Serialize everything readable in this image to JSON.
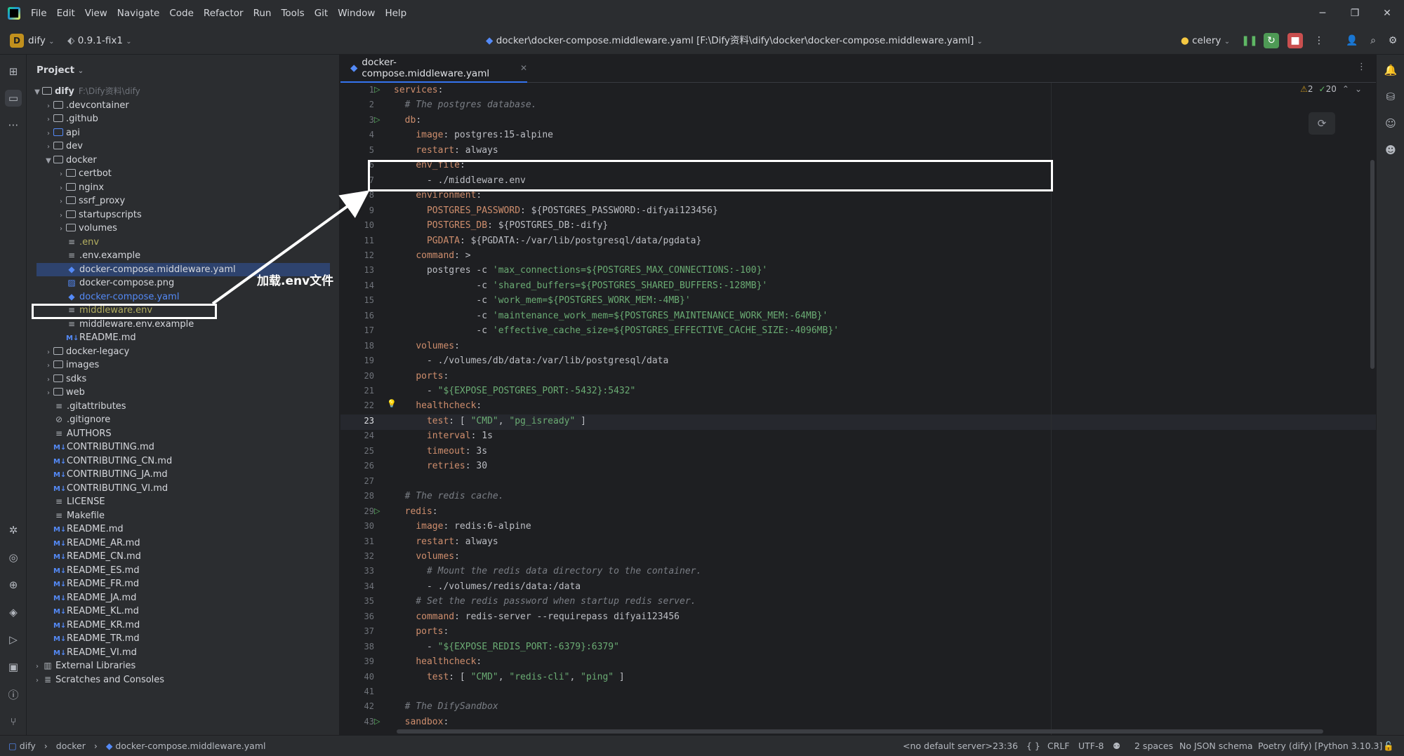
{
  "menu": [
    "File",
    "Edit",
    "View",
    "Navigate",
    "Code",
    "Refactor",
    "Run",
    "Tools",
    "Git",
    "Window",
    "Help"
  ],
  "toolbar": {
    "project_badge": "D",
    "project_name": "dify",
    "branch": "0.9.1-fix1",
    "file_path": "docker\\docker-compose.middleware.yaml [F:\\Dify资料\\dify\\docker\\docker-compose.middleware.yaml]",
    "run_config": "celery"
  },
  "project_panel": {
    "title": "Project",
    "root_name": "dify",
    "root_path": "F:\\Dify资料\\dify",
    "items": [
      {
        "label": ".devcontainer"
      },
      {
        "label": ".github"
      },
      {
        "label": "api"
      },
      {
        "label": "dev"
      },
      {
        "label": "docker"
      },
      {
        "label": "certbot"
      },
      {
        "label": "nginx"
      },
      {
        "label": "ssrf_proxy"
      },
      {
        "label": "startupscripts"
      },
      {
        "label": "volumes"
      },
      {
        "label": ".env"
      },
      {
        "label": ".env.example"
      },
      {
        "label": "docker-compose.middleware.yaml"
      },
      {
        "label": "docker-compose.png"
      },
      {
        "label": "docker-compose.yaml"
      },
      {
        "label": "middleware.env"
      },
      {
        "label": "middleware.env.example"
      },
      {
        "label": "README.md"
      },
      {
        "label": "docker-legacy"
      },
      {
        "label": "images"
      },
      {
        "label": "sdks"
      },
      {
        "label": "web"
      },
      {
        "label": ".gitattributes"
      },
      {
        "label": ".gitignore"
      },
      {
        "label": "AUTHORS"
      },
      {
        "label": "CONTRIBUTING.md"
      },
      {
        "label": "CONTRIBUTING_CN.md"
      },
      {
        "label": "CONTRIBUTING_JA.md"
      },
      {
        "label": "CONTRIBUTING_VI.md"
      },
      {
        "label": "LICENSE"
      },
      {
        "label": "Makefile"
      },
      {
        "label": "README.md"
      },
      {
        "label": "README_AR.md"
      },
      {
        "label": "README_CN.md"
      },
      {
        "label": "README_ES.md"
      },
      {
        "label": "README_FR.md"
      },
      {
        "label": "README_JA.md"
      },
      {
        "label": "README_KL.md"
      },
      {
        "label": "README_KR.md"
      },
      {
        "label": "README_TR.md"
      },
      {
        "label": "README_VI.md"
      },
      {
        "label": "External Libraries"
      },
      {
        "label": "Scratches and Consoles"
      }
    ]
  },
  "annotation": {
    "label": "加载.env文件"
  },
  "editor": {
    "tab_label": "docker-compose.middleware.yaml",
    "warnings": "2",
    "checks": "20",
    "line_numbers": [
      "1",
      "2",
      "3",
      "4",
      "5",
      "6",
      "7",
      "8",
      "9",
      "10",
      "11",
      "12",
      "13",
      "14",
      "15",
      "16",
      "17",
      "18",
      "19",
      "20",
      "21",
      "22",
      "23",
      "24",
      "25",
      "26",
      "27",
      "28",
      "29",
      "30",
      "31",
      "32",
      "33",
      "34",
      "35",
      "36",
      "37",
      "38",
      "39",
      "40",
      "41",
      "42",
      "43"
    ],
    "lines": [
      "services:",
      "  # The postgres database.",
      "  db:",
      "    image: postgres:15-alpine",
      "    restart: always",
      "    env_file:",
      "      - ./middleware.env",
      "    environment:",
      "      POSTGRES_PASSWORD: ${POSTGRES_PASSWORD:-difyai123456}",
      "      POSTGRES_DB: ${POSTGRES_DB:-dify}",
      "      PGDATA: ${PGDATA:-/var/lib/postgresql/data/pgdata}",
      "    command: >",
      "      postgres -c 'max_connections=${POSTGRES_MAX_CONNECTIONS:-100}'",
      "               -c 'shared_buffers=${POSTGRES_SHARED_BUFFERS:-128MB}'",
      "               -c 'work_mem=${POSTGRES_WORK_MEM:-4MB}'",
      "               -c 'maintenance_work_mem=${POSTGRES_MAINTENANCE_WORK_MEM:-64MB}'",
      "               -c 'effective_cache_size=${POSTGRES_EFFECTIVE_CACHE_SIZE:-4096MB}'",
      "    volumes:",
      "      - ./volumes/db/data:/var/lib/postgresql/data",
      "    ports:",
      "      - \"${EXPOSE_POSTGRES_PORT:-5432}:5432\"",
      "    healthcheck:",
      "      test: [ \"CMD\", \"pg_isready\" ]",
      "      interval: 1s",
      "      timeout: 3s",
      "      retries: 30",
      "",
      "  # The redis cache.",
      "  redis:",
      "    image: redis:6-alpine",
      "    restart: always",
      "    volumes:",
      "      # Mount the redis data directory to the container.",
      "      - ./volumes/redis/data:/data",
      "    # Set the redis password when startup redis server.",
      "    command: redis-server --requirepass difyai123456",
      "    ports:",
      "      - \"${EXPOSE_REDIS_PORT:-6379}:6379\"",
      "    healthcheck:",
      "      test: [ \"CMD\", \"redis-cli\", \"ping\" ]",
      "",
      "  # The DifySandbox",
      "  sandbox:"
    ]
  },
  "statusbar": {
    "crumb_root": "dify",
    "crumb_dir": "docker",
    "crumb_file": "docker-compose.middleware.yaml",
    "server": "<no default server>",
    "position": "23:36",
    "braces": "{ }",
    "line_sep": "CRLF",
    "encoding": "UTF-8",
    "indent": "2 spaces",
    "schema": "No JSON schema",
    "interpreter": "Poetry (dify) [Python 3.10.3]"
  },
  "colors": {
    "background": "#1e1f22",
    "panel": "#2b2d30",
    "keyword": "#cf8e6d",
    "string": "#6aab73",
    "comment": "#7a7e85",
    "accent": "#3574f0",
    "selection": "#2e436e"
  }
}
